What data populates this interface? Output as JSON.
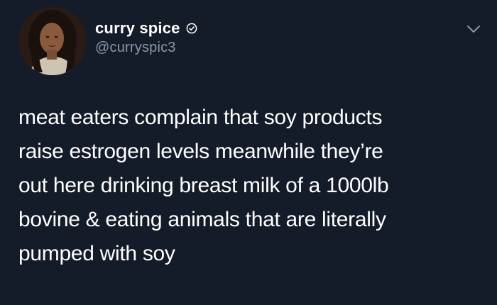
{
  "tweet": {
    "author": {
      "display_name": "curry spice",
      "handle": "@curryspic3",
      "verified": true
    },
    "text_lines": [
      "meat eaters complain that soy products",
      "raise estrogen levels meanwhile they’re",
      "out here drinking breast milk of a 1000lb",
      "bovine & eating animals that are literally",
      "pumped with soy"
    ]
  },
  "icons": {
    "avatar": "profile-photo",
    "verified": "verified-badge-icon",
    "menu": "chevron-down-icon"
  },
  "colors": {
    "background": "#151c29",
    "text": "#ffffff",
    "secondary_text": "#8a97a6"
  }
}
